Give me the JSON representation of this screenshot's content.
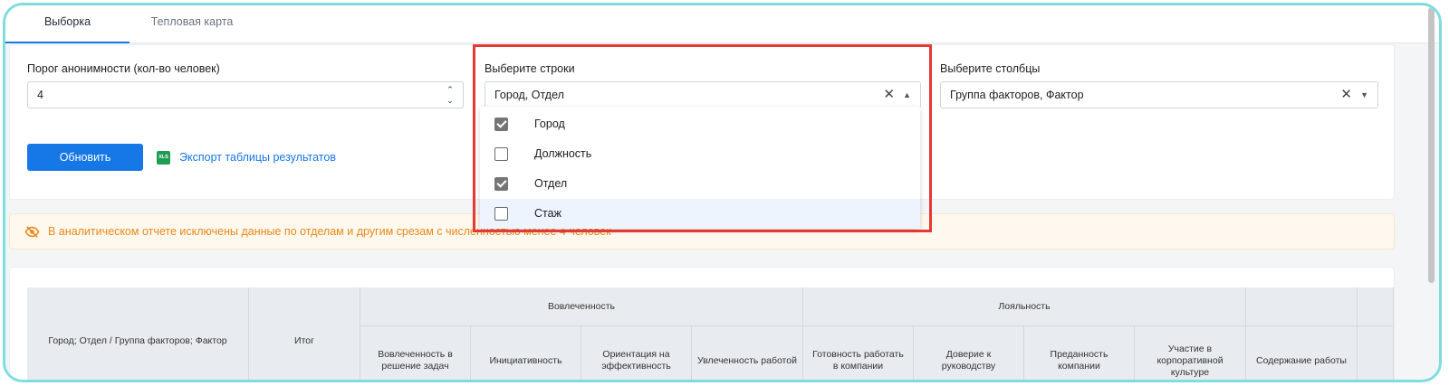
{
  "tabs": [
    {
      "label": "Выборка",
      "active": true
    },
    {
      "label": "Тепловая карта",
      "active": false
    }
  ],
  "filters": {
    "threshold_label": "Порог анонимности (кол-во человек)",
    "threshold_value": "4",
    "rows_label": "Выберите строки",
    "rows_value": "Город, Отдел",
    "cols_label": "Выберите столбцы",
    "cols_value": "Группа факторов, Фактор"
  },
  "dropdown": {
    "options": [
      {
        "label": "Город",
        "checked": true
      },
      {
        "label": "Должность",
        "checked": false
      },
      {
        "label": "Отдел",
        "checked": true
      },
      {
        "label": "Стаж",
        "checked": false
      }
    ]
  },
  "actions": {
    "refresh_label": "Обновить",
    "xls_badge": "XLS",
    "export_label": "Экспорт таблицы результатов"
  },
  "warning": {
    "text": "В аналитическом отчете исключены данные по отделам и другим срезам с численностью менее 4 человек"
  },
  "table": {
    "corner": "Город; Отдел   / Группа факторов; Фактор",
    "total": "Итог",
    "groups": [
      "Вовлеченность",
      "Лояльность"
    ],
    "columns": [
      "Вовлеченность в решение задач",
      "Инициативность",
      "Ориентация на эффективность",
      "Увлеченность работой",
      "Готовность работать в компании",
      "Доверие к руководству",
      "Преданность компании",
      "Участие в корпоративной культуре",
      "Содержание работы"
    ]
  },
  "colors": {
    "accent": "#1677e6",
    "warning": "#e8891a",
    "frame": "#7fdde1",
    "annotation": "#e53935"
  }
}
